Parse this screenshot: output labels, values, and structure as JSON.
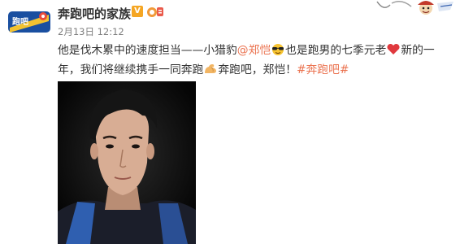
{
  "account": {
    "name": "奔跑吧的家族",
    "vip_badge": "V",
    "avatar_icon": "running-man-logo-icon",
    "member_badge_icon": "vip-member-badge-icon"
  },
  "post": {
    "date": "2月13日 12:12",
    "text_before_mention": "他是伐木累中的速度担当——小猎豹",
    "mention": "@郑恺",
    "emoji_sunglasses_icon": "sunglasses-emoji-icon",
    "text_mid": "也是跑男的七季元老",
    "emoji_heart_icon": "red-heart-emoji-icon",
    "text_mid2": "新的一年，我们将继续携手一同奔跑",
    "emoji_muscle_icon": "flexed-biceps-emoji-icon",
    "text_after": "奔跑吧，郑恺！",
    "hashtag": "#奔跑吧#"
  },
  "image": {
    "icon": "portrait-photo-icon"
  },
  "follow_card": {
    "icon": "cartoon-character-icon"
  },
  "colors": {
    "link": "#eb7350",
    "vip": "#f5a623",
    "text": "#333333",
    "meta": "#808080"
  }
}
